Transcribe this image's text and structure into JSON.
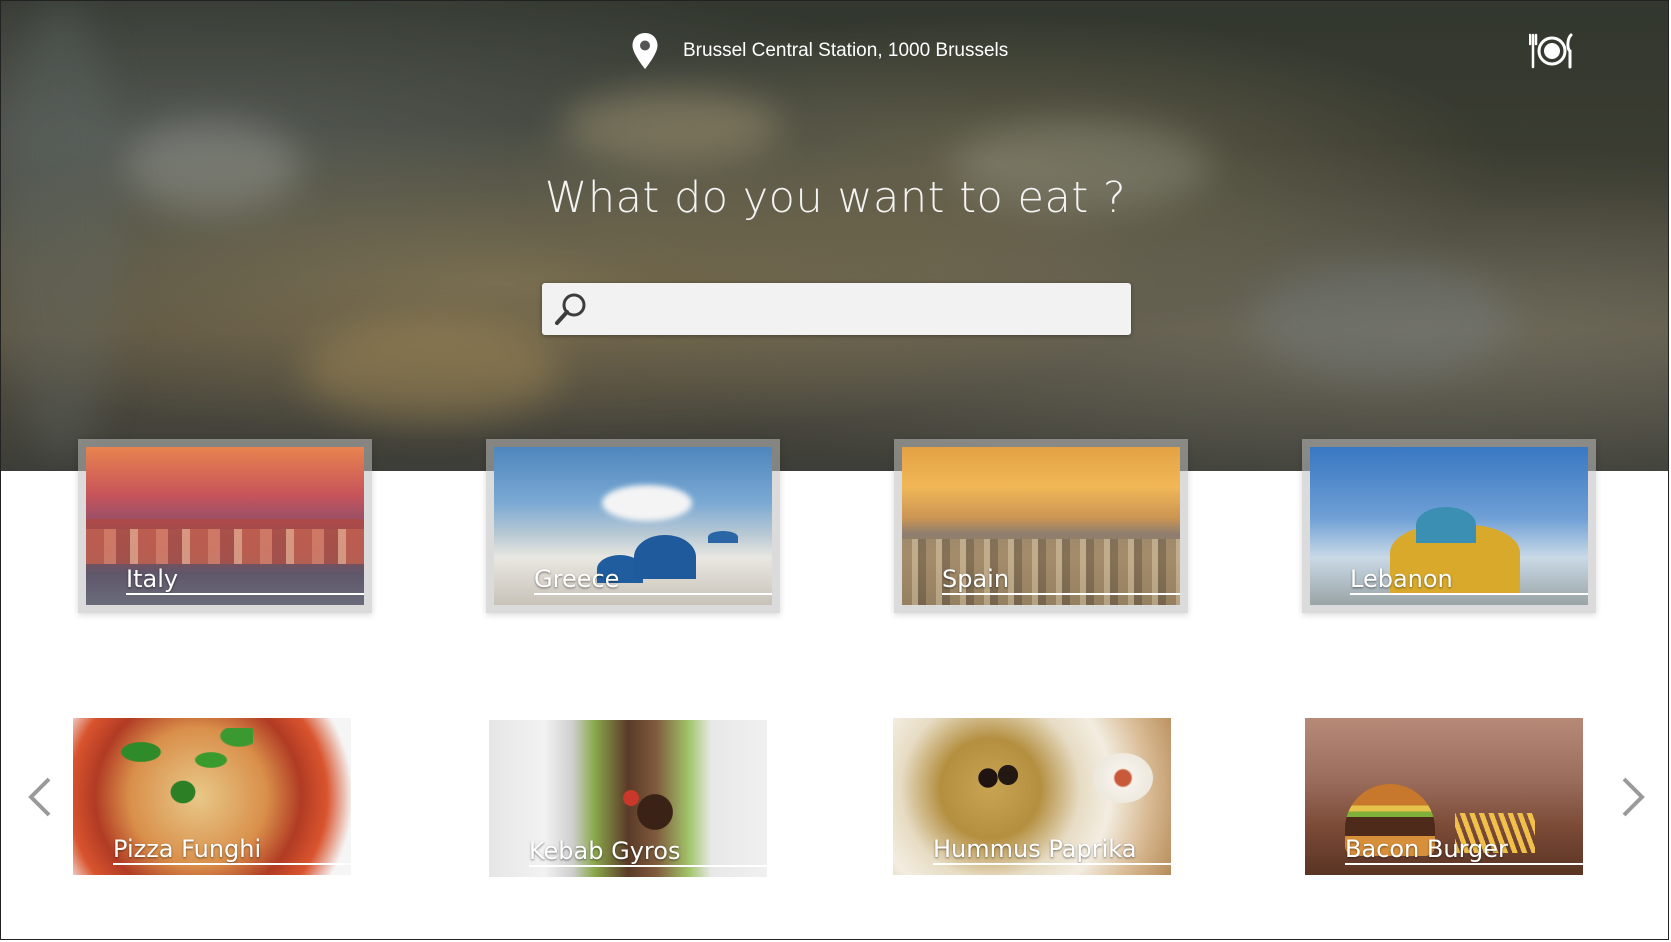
{
  "header": {
    "location": "Brussel Central Station, 1000 Brussels",
    "location_icon": "map-pin-icon",
    "dining_icon": "plate-fork-knife-icon"
  },
  "hero": {
    "headline": "What do you want to eat ?"
  },
  "search": {
    "value": "",
    "placeholder": "",
    "icon": "search-icon"
  },
  "countries": [
    {
      "label": "Italy"
    },
    {
      "label": "Greece"
    },
    {
      "label": "Spain"
    },
    {
      "label": "Lebanon"
    }
  ],
  "dishes": [
    {
      "label": "Pizza Funghi"
    },
    {
      "label": "Kebab Gyros"
    },
    {
      "label": "Hummus Paprika"
    },
    {
      "label": "Bacon Burger"
    }
  ],
  "carousel": {
    "prev_icon": "chevron-left-icon",
    "next_icon": "chevron-right-icon"
  }
}
